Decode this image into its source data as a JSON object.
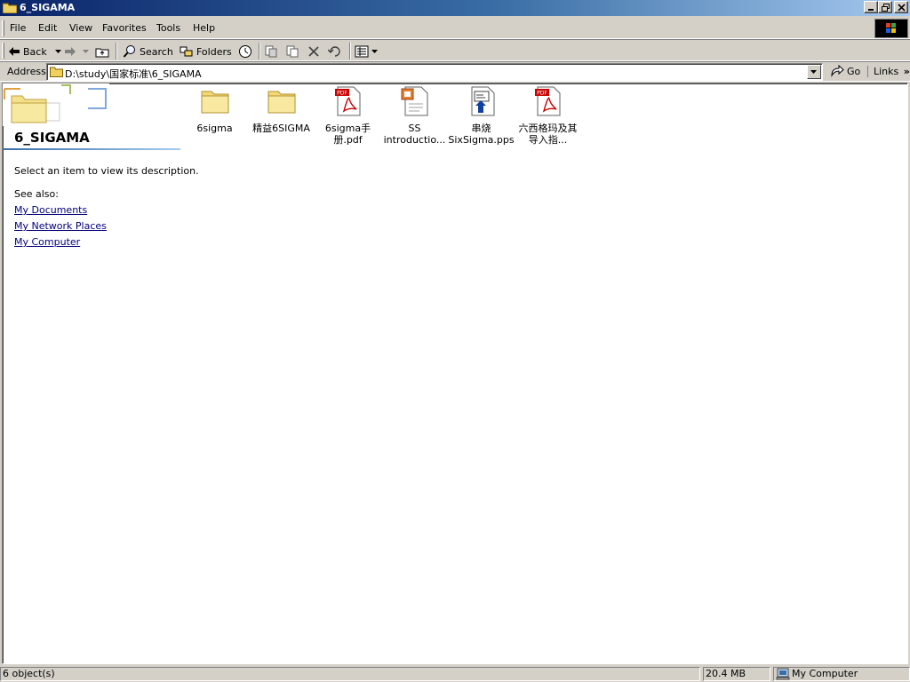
{
  "window": {
    "title": "6_SIGAMA",
    "controls": [
      "minimize",
      "restore",
      "close"
    ]
  },
  "menu": {
    "items": [
      "File",
      "Edit",
      "View",
      "Favorites",
      "Tools",
      "Help"
    ]
  },
  "toolbar": {
    "back_label": "Back",
    "search_label": "Search",
    "folders_label": "Folders"
  },
  "address": {
    "label": "Address",
    "value": "D:\\study\\国家标准\\6_SIGAMA",
    "go_label": "Go",
    "links_label": "Links"
  },
  "task_pane": {
    "folder_name": "6_SIGAMA",
    "description": "Select an item to view its description.",
    "see_also_label": "See also:",
    "links": [
      "My Documents",
      "My Network Places",
      "My Computer"
    ]
  },
  "files": [
    {
      "name": "6sigma",
      "type": "folder"
    },
    {
      "name": "精益6SIGMA",
      "type": "folder"
    },
    {
      "name": "6sigma手册.pdf",
      "type": "pdf"
    },
    {
      "name": "SS introductio...",
      "type": "ppt"
    },
    {
      "name": "串烧 SixSigma.pps",
      "type": "pps"
    },
    {
      "name": "六西格玛及其导入指...",
      "type": "pdf"
    }
  ],
  "status": {
    "objects": "6 object(s)",
    "size": "20.4 MB",
    "zone": "My Computer"
  },
  "colors": {
    "title_bar_start": "#0a246a",
    "title_bar_end": "#a6caf0",
    "chrome": "#d4d0c8",
    "link": "#00007b",
    "pdf_red": "#cc0000"
  }
}
